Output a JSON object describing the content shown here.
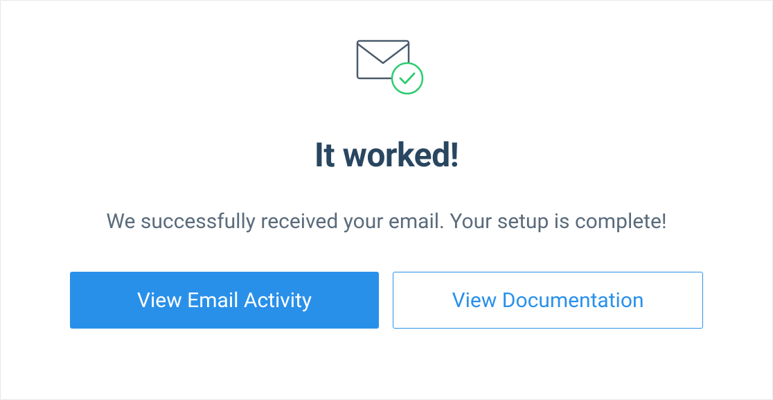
{
  "heading": "It worked!",
  "message": "We successfully received your email. Your setup is complete!",
  "buttons": {
    "primary_label": "View Email Activity",
    "secondary_label": "View Documentation"
  },
  "colors": {
    "accent": "#2990ea",
    "heading": "#294661",
    "text": "#5a6b7b",
    "success": "#2ecc71"
  }
}
